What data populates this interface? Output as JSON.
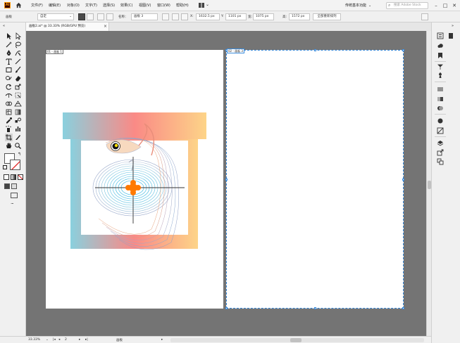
{
  "app": {
    "logo": "Ai",
    "menu": [
      "文件(F)",
      "编辑(E)",
      "对象(O)",
      "文字(T)",
      "选择(S)",
      "效果(C)",
      "视图(V)",
      "窗口(W)",
      "帮助(H)"
    ],
    "workspace": "传统基本功能",
    "search_placeholder": "搜索 Adobe Stock"
  },
  "control_bar": {
    "panel_label": "画板",
    "preset": "自定",
    "name_label": "名称：",
    "name_value": "画板 3",
    "x_label": "X:",
    "x_value": "1632.5 px",
    "y_label": "Y:",
    "y_value": "1101 px",
    "w_label": "宽:",
    "w_value": "1075 px",
    "h_label": "高:",
    "h_value": "1572 px",
    "rearrange_label": "全部重新排列"
  },
  "document": {
    "tab_title": "画板2.ai* @ 33.33% (RGB/GPU 预览)",
    "close": "×"
  },
  "artboards": [
    {
      "label": "01 - 画板 1"
    },
    {
      "label": "02 - 画板 3"
    }
  ],
  "status": {
    "zoom": "33.33%",
    "page": "2",
    "mode": "画板"
  },
  "colors": {
    "selection": "#3a8bdc",
    "canvas": "#747474",
    "frame_left": "#8ad0de",
    "frame_mid": "#fa8a86",
    "frame_right": "#fdd488",
    "accent_orange": "#ff7a00"
  },
  "icons": [
    "home-icon",
    "selection-tool-icon",
    "direct-selection-tool-icon",
    "pen-tool-icon",
    "type-tool-icon",
    "rectangle-tool-icon",
    "brush-tool-icon",
    "rotate-tool-icon",
    "hand-tool-icon",
    "zoom-tool-icon",
    "eyedropper-tool-icon",
    "gradient-tool-icon",
    "artboard-tool-icon",
    "layers-icon",
    "properties-icon"
  ]
}
